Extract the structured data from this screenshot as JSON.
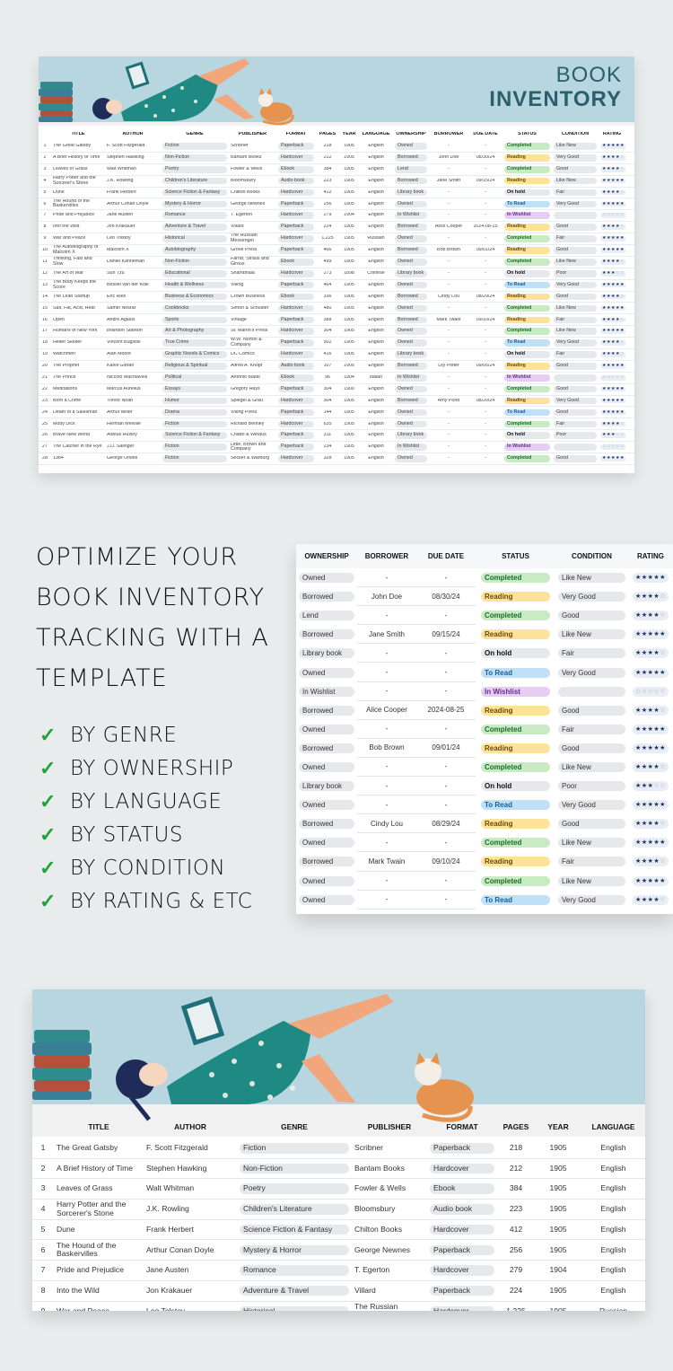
{
  "hero": {
    "title_line1": "BOOK",
    "title_line2": "INVENTORY"
  },
  "columns": {
    "num": "",
    "title": "TITLE",
    "author": "AUTHOR",
    "genre": "GENRE",
    "publisher": "PUBLISHER",
    "format": "FORMAT",
    "pages": "PAGES",
    "year": "YEAR",
    "language": "LANGUAGE",
    "ownership": "OWNERSHIP",
    "borrower": "BORROWER",
    "due_date": "DUE DATE",
    "status": "STATUS",
    "condition": "CONDITION",
    "rating": "RATING"
  },
  "books": [
    {
      "num": "1",
      "title": "The Great Gatsby",
      "author": "F. Scott Fitzgerald",
      "genre": "Fiction",
      "publisher": "Scribner",
      "format": "Paperback",
      "pages": "218",
      "year": "1905",
      "language": "English",
      "ownership": "Owned",
      "borrower": "-",
      "due_date": "-",
      "status": "Completed",
      "condition": "Like New",
      "rating": 5
    },
    {
      "num": "2",
      "title": "A Brief History of Time",
      "author": "Stephen Hawking",
      "genre": "Non-Fiction",
      "publisher": "Bantam Books",
      "format": "Hardcover",
      "pages": "212",
      "year": "1905",
      "language": "English",
      "ownership": "Borrowed",
      "borrower": "John Doe",
      "due_date": "08/30/24",
      "status": "Reading",
      "condition": "Very Good",
      "rating": 4
    },
    {
      "num": "3",
      "title": "Leaves of Grass",
      "author": "Walt Whitman",
      "genre": "Poetry",
      "publisher": "Fowler & Wells",
      "format": "Ebook",
      "pages": "384",
      "year": "1905",
      "language": "English",
      "ownership": "Lend",
      "borrower": "-",
      "due_date": "-",
      "status": "Completed",
      "condition": "Good",
      "rating": 4
    },
    {
      "num": "4",
      "title": "Harry Potter and the Sorcerer's Stone",
      "author": "J.K. Rowling",
      "genre": "Children's Literature",
      "publisher": "Bloomsbury",
      "format": "Audio book",
      "pages": "223",
      "year": "1905",
      "language": "English",
      "ownership": "Borrowed",
      "borrower": "Jane Smith",
      "due_date": "09/15/24",
      "status": "Reading",
      "condition": "Like New",
      "rating": 5
    },
    {
      "num": "5",
      "title": "Dune",
      "author": "Frank Herbert",
      "genre": "Science Fiction & Fantasy",
      "publisher": "Chilton Books",
      "format": "Hardcover",
      "pages": "412",
      "year": "1905",
      "language": "English",
      "ownership": "Library book",
      "borrower": "-",
      "due_date": "-",
      "status": "On hold",
      "condition": "Fair",
      "rating": 4
    },
    {
      "num": "6",
      "title": "The Hound of the Baskervilles",
      "author": "Arthur Conan Doyle",
      "genre": "Mystery & Horror",
      "publisher": "George Newnes",
      "format": "Paperback",
      "pages": "256",
      "year": "1905",
      "language": "English",
      "ownership": "Owned",
      "borrower": "-",
      "due_date": "-",
      "status": "To Read",
      "condition": "Very Good",
      "rating": 5
    },
    {
      "num": "7",
      "title": "Pride and Prejudice",
      "author": "Jane Austen",
      "genre": "Romance",
      "publisher": "T. Egerton",
      "format": "Hardcover",
      "pages": "279",
      "year": "1904",
      "language": "English",
      "ownership": "In Wishlist",
      "borrower": "-",
      "due_date": "-",
      "status": "In Wishlist",
      "condition": "",
      "rating": 0
    },
    {
      "num": "8",
      "title": "Into the Wild",
      "author": "Jon Krakauer",
      "genre": "Adventure & Travel",
      "publisher": "Villard",
      "format": "Paperback",
      "pages": "224",
      "year": "1905",
      "language": "English",
      "ownership": "Borrowed",
      "borrower": "Alice Cooper",
      "due_date": "2024-08-25",
      "status": "Reading",
      "condition": "Good",
      "rating": 4
    },
    {
      "num": "9",
      "title": "War and Peace",
      "author": "Leo Tolstoy",
      "genre": "Historical",
      "publisher": "The Russian Messenger",
      "format": "Hardcover",
      "pages": "1,225",
      "year": "1905",
      "language": "Russian",
      "ownership": "Owned",
      "borrower": "-",
      "due_date": "-",
      "status": "Completed",
      "condition": "Fair",
      "rating": 5
    },
    {
      "num": "10",
      "title": "The Autobiography of Malcolm X",
      "author": "Malcolm X",
      "genre": "Autobiography",
      "publisher": "Grove Press",
      "format": "Paperback",
      "pages": "466",
      "year": "1905",
      "language": "English",
      "ownership": "Borrowed",
      "borrower": "Bob Brown",
      "due_date": "09/01/24",
      "status": "Reading",
      "condition": "Good",
      "rating": 5
    },
    {
      "num": "11",
      "title": "Thinking, Fast and Slow",
      "author": "Daniel Kahneman",
      "genre": "Non-Fiction",
      "publisher": "Farrar, Straus and Giroux",
      "format": "Ebook",
      "pages": "499",
      "year": "1905",
      "language": "English",
      "ownership": "Owned",
      "borrower": "-",
      "due_date": "-",
      "status": "Completed",
      "condition": "Like New",
      "rating": 4
    },
    {
      "num": "12",
      "title": "The Art of War",
      "author": "Sun Tzu",
      "genre": "Educational",
      "publisher": "Shambhala",
      "format": "Hardcover",
      "pages": "273",
      "year": "1898",
      "language": "Chinese",
      "ownership": "Library book",
      "borrower": "-",
      "due_date": "-",
      "status": "On hold",
      "condition": "Poor",
      "rating": 3
    },
    {
      "num": "13",
      "title": "The Body Keeps the Score",
      "author": "Bessel van der Kolk",
      "genre": "Health & Wellness",
      "publisher": "Viking",
      "format": "Paperback",
      "pages": "464",
      "year": "1905",
      "language": "English",
      "ownership": "Owned",
      "borrower": "-",
      "due_date": "-",
      "status": "To Read",
      "condition": "Very Good",
      "rating": 5
    },
    {
      "num": "14",
      "title": "The Lean Startup",
      "author": "Eric Ries",
      "genre": "Business & Economics",
      "publisher": "Crown Business",
      "format": "Ebook",
      "pages": "336",
      "year": "1905",
      "language": "English",
      "ownership": "Borrowed",
      "borrower": "Cindy Lou",
      "due_date": "08/29/24",
      "status": "Reading",
      "condition": "Good",
      "rating": 4
    },
    {
      "num": "15",
      "title": "Salt, Fat, Acid, Heat",
      "author": "Samin Nosrat",
      "genre": "Cookbooks",
      "publisher": "Simon & Schuster",
      "format": "Hardcover",
      "pages": "480",
      "year": "1905",
      "language": "English",
      "ownership": "Owned",
      "borrower": "-",
      "due_date": "-",
      "status": "Completed",
      "condition": "Like New",
      "rating": 5
    },
    {
      "num": "16",
      "title": "Open",
      "author": "Andre Agassi",
      "genre": "Sports",
      "publisher": "Vintage",
      "format": "Paperback",
      "pages": "388",
      "year": "1905",
      "language": "English",
      "ownership": "Borrowed",
      "borrower": "Mark Twain",
      "due_date": "09/10/24",
      "status": "Reading",
      "condition": "Fair",
      "rating": 4
    },
    {
      "num": "17",
      "title": "Humans of New York",
      "author": "Brandon Stanton",
      "genre": "Art & Photography",
      "publisher": "St. Martin's Press",
      "format": "Hardcover",
      "pages": "304",
      "year": "1905",
      "language": "English",
      "ownership": "Owned",
      "borrower": "-",
      "due_date": "-",
      "status": "Completed",
      "condition": "Like New",
      "rating": 5
    },
    {
      "num": "18",
      "title": "Helter Skelter",
      "author": "Vincent Bugliosi",
      "genre": "True Crime",
      "publisher": "W.W. Norton & Company",
      "format": "Paperback",
      "pages": "502",
      "year": "1905",
      "language": "English",
      "ownership": "Owned",
      "borrower": "-",
      "due_date": "-",
      "status": "To Read",
      "condition": "Very Good",
      "rating": 4
    },
    {
      "num": "19",
      "title": "Watchmen",
      "author": "Alan Moore",
      "genre": "Graphic Novels & Comics",
      "publisher": "DC Comics",
      "format": "Hardcover",
      "pages": "416",
      "year": "1905",
      "language": "English",
      "ownership": "Library book",
      "borrower": "-",
      "due_date": "-",
      "status": "On hold",
      "condition": "Fair",
      "rating": 4
    },
    {
      "num": "20",
      "title": "The Prophet",
      "author": "Kahlil Gibran",
      "genre": "Religious & Spiritual",
      "publisher": "Alfred A. Knopf",
      "format": "Audio book",
      "pages": "107",
      "year": "1905",
      "language": "English",
      "ownership": "Borrowed",
      "borrower": "Lily Potter",
      "due_date": "09/05/24",
      "status": "Reading",
      "condition": "Good",
      "rating": 5
    },
    {
      "num": "21",
      "title": "The Prince",
      "author": "Niccolò Machiavelli",
      "genre": "Political",
      "publisher": "Antonio Blado",
      "format": "Ebook",
      "pages": "96",
      "year": "1904",
      "language": "Italian",
      "ownership": "In Wishlist",
      "borrower": "-",
      "due_date": "-",
      "status": "In Wishlist",
      "condition": "",
      "rating": 0
    },
    {
      "num": "22",
      "title": "Meditations",
      "author": "Marcus Aurelius",
      "genre": "Essays",
      "publisher": "Gregory Hays",
      "format": "Paperback",
      "pages": "304",
      "year": "1900",
      "language": "English",
      "ownership": "Owned",
      "borrower": "-",
      "due_date": "-",
      "status": "Completed",
      "condition": "Good",
      "rating": 5
    },
    {
      "num": "23",
      "title": "Born a Crime",
      "author": "Trevor Noah",
      "genre": "Humor",
      "publisher": "Spiegel & Grau",
      "format": "Hardcover",
      "pages": "304",
      "year": "1905",
      "language": "English",
      "ownership": "Borrowed",
      "borrower": "Amy Pond",
      "due_date": "08/20/24",
      "status": "Reading",
      "condition": "Very Good",
      "rating": 5
    },
    {
      "num": "24",
      "title": "Death of a Salesman",
      "author": "Arthur Miller",
      "genre": "Drama",
      "publisher": "Viking Press",
      "format": "Paperback",
      "pages": "144",
      "year": "1905",
      "language": "English",
      "ownership": "Owned",
      "borrower": "-",
      "due_date": "-",
      "status": "To Read",
      "condition": "Good",
      "rating": 5
    },
    {
      "num": "25",
      "title": "Moby Dick",
      "author": "Herman Melville",
      "genre": "Fiction",
      "publisher": "Richard Bentley",
      "format": "Hardcover",
      "pages": "635",
      "year": "1905",
      "language": "English",
      "ownership": "Owned",
      "borrower": "-",
      "due_date": "-",
      "status": "Completed",
      "condition": "Fair",
      "rating": 4
    },
    {
      "num": "26",
      "title": "Brave New World",
      "author": "Aldous Huxley",
      "genre": "Science Fiction & Fantasy",
      "publisher": "Chatto & Windus",
      "format": "Paperback",
      "pages": "311",
      "year": "1905",
      "language": "English",
      "ownership": "Library book",
      "borrower": "-",
      "due_date": "-",
      "status": "On hold",
      "condition": "Poor",
      "rating": 3
    },
    {
      "num": "27",
      "title": "The Catcher in the Rye",
      "author": "J.D. Salinger",
      "genre": "Fiction",
      "publisher": "Little, Brown and Company",
      "format": "Paperback",
      "pages": "234",
      "year": "1905",
      "language": "English",
      "ownership": "In Wishlist",
      "borrower": "-",
      "due_date": "-",
      "status": "In Wishlist",
      "condition": "",
      "rating": 0
    },
    {
      "num": "28",
      "title": "1984",
      "author": "George Orwell",
      "genre": "Fiction",
      "publisher": "Secker & Warburg",
      "format": "Hardcover",
      "pages": "328",
      "year": "1905",
      "language": "English",
      "ownership": "Owned",
      "borrower": "-",
      "due_date": "-",
      "status": "Completed",
      "condition": "Good",
      "rating": 5
    }
  ],
  "promo": {
    "headline": [
      "OPTIMIZE YOUR",
      "BOOK INVENTORY",
      "TRACKING WITH A",
      "TEMPLATE"
    ],
    "check_icon": "✓",
    "features": [
      "BY GENRE",
      "BY OWNERSHIP",
      "BY LANGUAGE",
      "BY STATUS",
      "BY CONDITION",
      "BY RATING & ETC"
    ]
  },
  "status_colors": {
    "Completed": "#c9ebc4",
    "Reading": "#fde39a",
    "To Read": "#bfe0f5",
    "In Wishlist": "#e5cdf4",
    "On hold": "#e6e8ec"
  },
  "accent": {
    "banner": "#b8d6e0",
    "brand_text": "#2c5f6c",
    "check": "#1aa536",
    "star": "#1f3464"
  }
}
